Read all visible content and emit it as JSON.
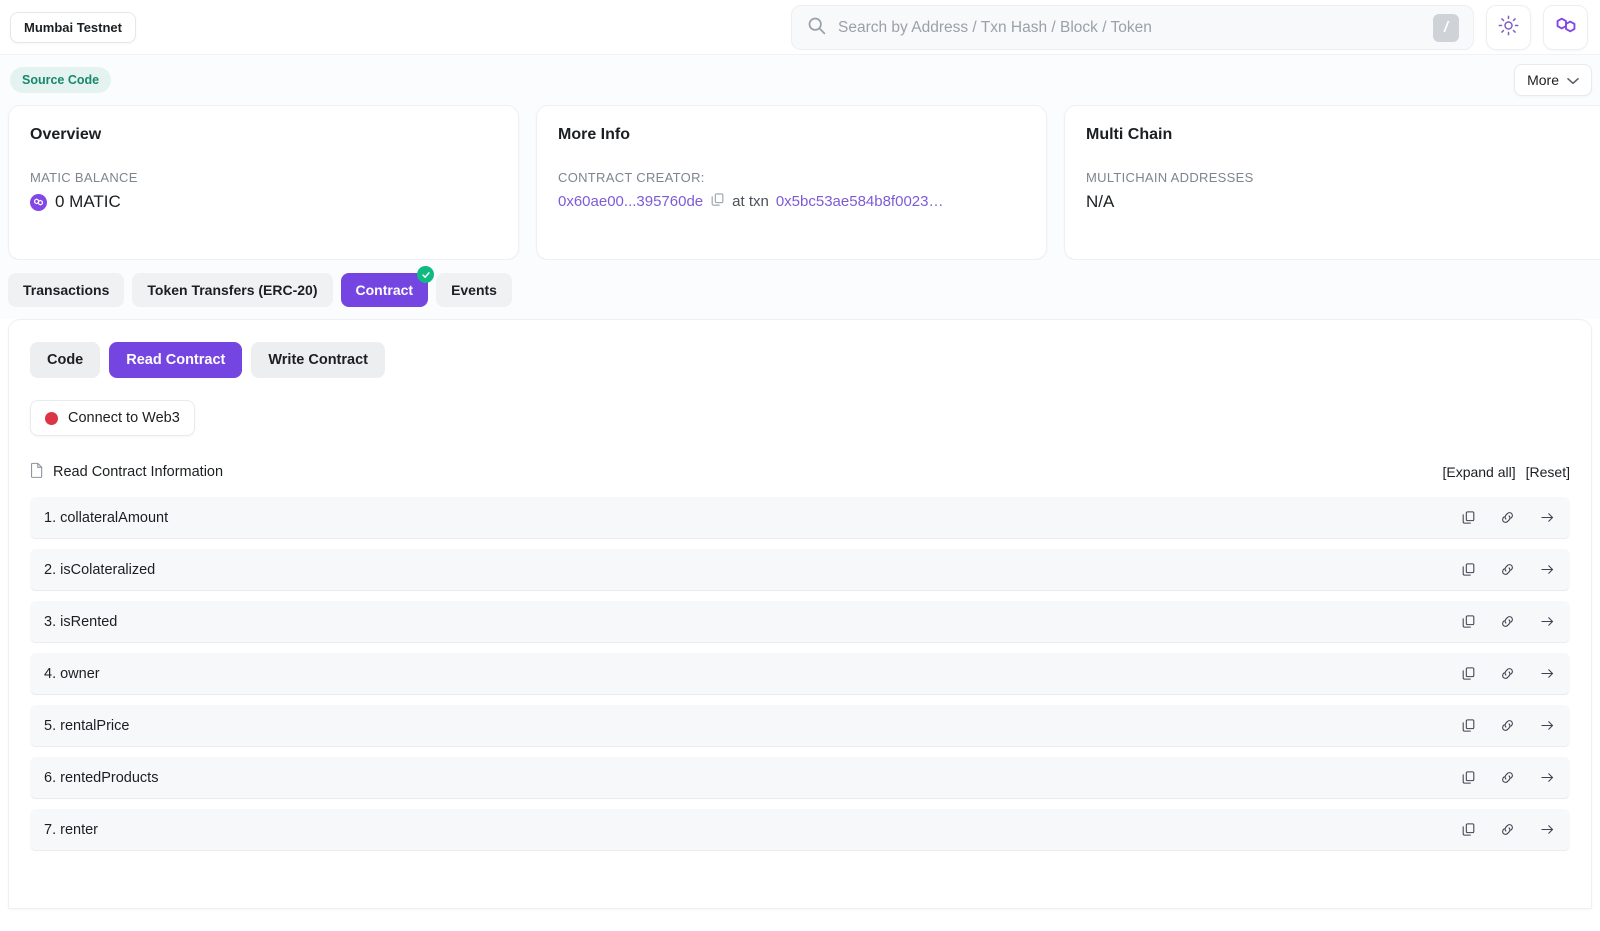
{
  "topbar": {
    "network_chip": "Mumbai Testnet",
    "search": {
      "placeholder": "Search by Address / Txn Hash / Block / Token",
      "value": "",
      "shortcut_key": "/",
      "icon": "search-icon"
    },
    "theme_toggle_icon": "sun-icon",
    "brand_icon": "polygon-logo-icon"
  },
  "subheader": {
    "source_code_badge": "Source Code",
    "more_button": "More",
    "more_chevron_icon": "chevron-down-icon"
  },
  "cards": {
    "overview": {
      "title": "Overview",
      "label": "MATIC BALANCE",
      "value": "0 MATIC",
      "token_icon": "matic-token-icon"
    },
    "more_info": {
      "title": "More Info",
      "label": "CONTRACT CREATOR:",
      "creator_address": "0x60ae00...395760de",
      "copy_icon": "copy-icon",
      "at_txn_text": "at txn",
      "txn_hash": "0x5bc53ae584b8f0023…"
    },
    "multi_chain": {
      "title": "Multi Chain",
      "label": "MULTICHAIN ADDRESSES",
      "value": "N/A"
    }
  },
  "tabs": [
    {
      "label": "Transactions",
      "active": false,
      "badge": false
    },
    {
      "label": "Token Transfers (ERC-20)",
      "active": false,
      "badge": false
    },
    {
      "label": "Contract",
      "active": true,
      "badge": true,
      "badge_icon": "check-icon"
    },
    {
      "label": "Events",
      "active": false,
      "badge": false
    }
  ],
  "contract_panel": {
    "subtabs": [
      {
        "label": "Code",
        "active": false
      },
      {
        "label": "Read Contract",
        "active": true
      },
      {
        "label": "Write Contract",
        "active": false
      }
    ],
    "connect_button": {
      "label": "Connect to Web3",
      "status_icon": "status-dot-icon",
      "status_color": "#dc3545"
    },
    "read_header": {
      "doc_icon": "document-icon",
      "title": "Read Contract Information",
      "expand_all": "[Expand all]",
      "reset": "[Reset]"
    },
    "functions": [
      {
        "label": "1. collateralAmount"
      },
      {
        "label": "2. isColateralized"
      },
      {
        "label": "3. isRented"
      },
      {
        "label": "4. owner"
      },
      {
        "label": "5. rentalPrice"
      },
      {
        "label": "6. rentedProducts"
      },
      {
        "label": "7. renter"
      }
    ],
    "row_action_icons": [
      "copy-icon",
      "link-icon",
      "arrow-right-icon"
    ]
  },
  "colors": {
    "accent_purple": "#7445e0",
    "link_purple": "#7c5cd6",
    "source_badge_bg": "#e4f3ef",
    "source_badge_fg": "#17876d",
    "badge_green": "#10b981",
    "status_red": "#dc3545",
    "matic_purple": "#8247e5"
  }
}
